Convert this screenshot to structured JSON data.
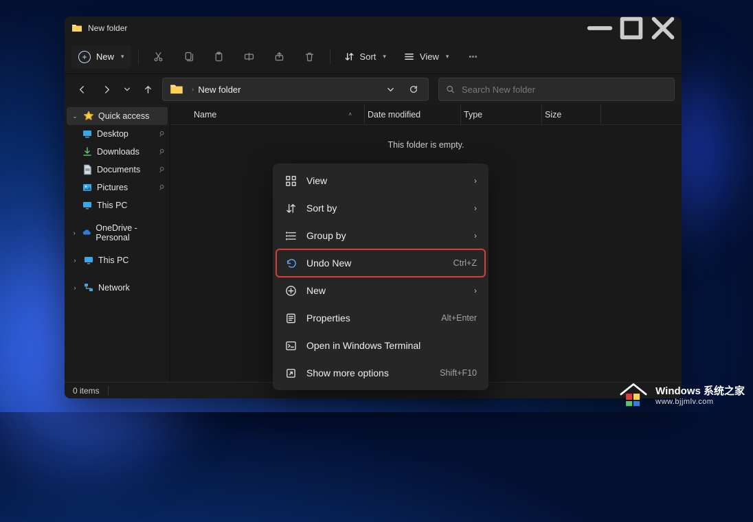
{
  "window": {
    "title": "New folder"
  },
  "toolbar": {
    "new_label": "New",
    "sort_label": "Sort",
    "view_label": "View"
  },
  "addressbar": {
    "crumbs": [
      "New folder"
    ]
  },
  "search": {
    "placeholder": "Search New folder"
  },
  "sidebar": {
    "quick_label": "Quick access",
    "quick": [
      {
        "label": "Desktop"
      },
      {
        "label": "Downloads"
      },
      {
        "label": "Documents"
      },
      {
        "label": "Pictures"
      },
      {
        "label": "This PC"
      }
    ],
    "onedrive": "OneDrive - Personal",
    "thispc": "This PC",
    "network": "Network"
  },
  "columns": {
    "name": "Name",
    "date": "Date modified",
    "type": "Type",
    "size": "Size"
  },
  "empty_msg": "This folder is empty.",
  "context_menu": {
    "view": "View",
    "sort_by": "Sort by",
    "group_by": "Group by",
    "undo": "Undo New",
    "undo_sh": "Ctrl+Z",
    "new": "New",
    "properties": "Properties",
    "properties_sh": "Alt+Enter",
    "terminal": "Open in Windows Terminal",
    "more": "Show more options",
    "more_sh": "Shift+F10"
  },
  "status": {
    "items": "0 items"
  },
  "watermark": {
    "line1": "Windows 系统之家",
    "line2": "www.bjjmlv.com"
  }
}
